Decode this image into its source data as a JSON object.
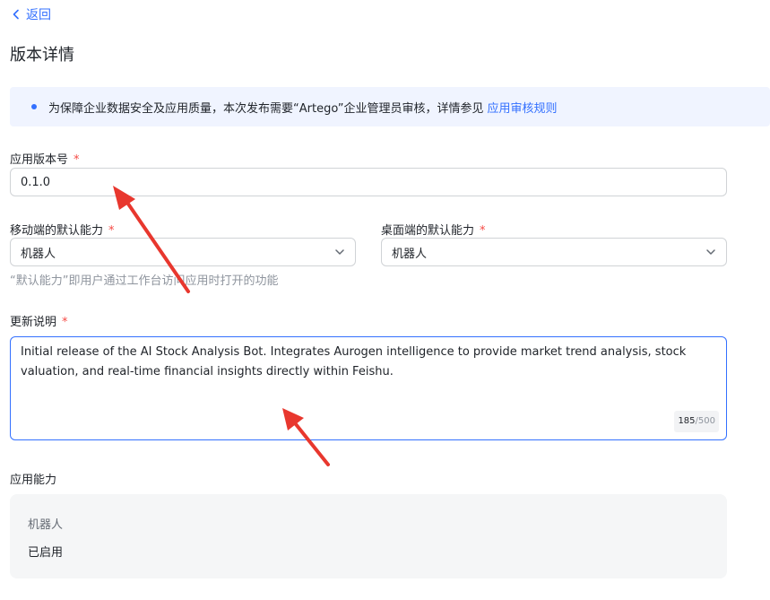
{
  "nav": {
    "back_label": "返回"
  },
  "page": {
    "title": "版本详情"
  },
  "notice": {
    "text": "为保障企业数据安全及应用质量，本次发布需要“Artego”企业管理员审核，详情参见",
    "link_label": "应用审核规则"
  },
  "form": {
    "version": {
      "label": "应用版本号",
      "required_mark": "*",
      "value": "0.1.0"
    },
    "mobile_default": {
      "label": "移动端的默认能力",
      "required_mark": "*",
      "value": "机器人"
    },
    "desktop_default": {
      "label": "桌面端的默认能力",
      "required_mark": "*",
      "value": "机器人"
    },
    "default_hint": "“默认能力”即用户通过工作台访问应用时打开的功能",
    "release_notes": {
      "label": "更新说明",
      "required_mark": "*",
      "value": "Initial release of the AI Stock Analysis Bot. Integrates Aurogen intelligence to provide market trend analysis, stock valuation, and real-time financial insights directly within Feishu.",
      "count": "185",
      "max": "/500"
    }
  },
  "capabilities": {
    "title": "应用能力",
    "items": [
      {
        "name": "机器人",
        "status": "已启用"
      }
    ]
  },
  "icons": {
    "back": "chevron-left-icon",
    "select": "chevron-down-icon",
    "annotation": "red-arrow-icon"
  },
  "colors": {
    "accent": "#3370ff",
    "required": "#f54a45",
    "notice_bg": "#f0f4ff",
    "annotation_arrow": "#e8372e"
  }
}
